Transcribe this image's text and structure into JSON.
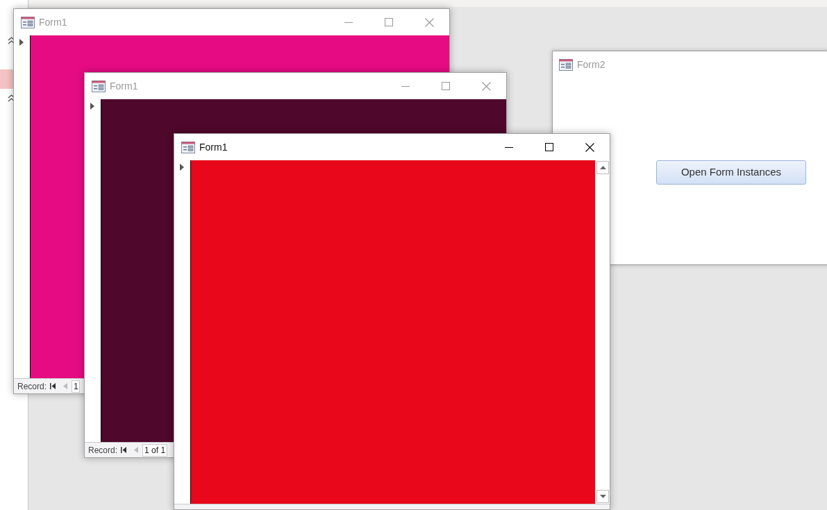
{
  "forms": [
    {
      "title": "Form1",
      "active": false,
      "color": "#e60b83",
      "record_label": "Record:",
      "record_value": "1"
    },
    {
      "title": "Form1",
      "active": false,
      "color": "#4f072c",
      "record_label": "Record:",
      "record_value": "1 of 1"
    },
    {
      "title": "Form1",
      "active": true,
      "color": "#e8071b"
    }
  ],
  "form2": {
    "title": "Form2",
    "active": false,
    "button": "Open Form Instances"
  }
}
